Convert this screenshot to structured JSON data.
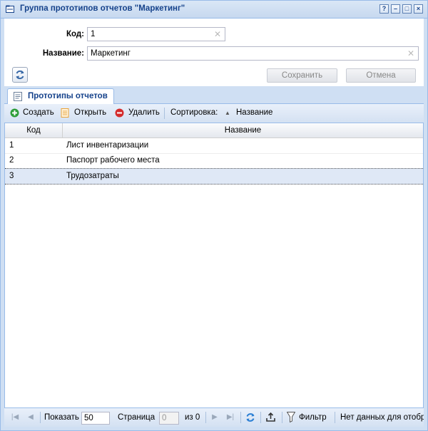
{
  "window": {
    "title": "Группа прототипов отчетов \"Маркетинг\"",
    "tools": {
      "help": "?",
      "minimize": "–",
      "maximize": "□",
      "close": "×"
    }
  },
  "form": {
    "code_label": "Код:",
    "code_value": "1",
    "name_label": "Название:",
    "name_value": "Маркетинг",
    "save_label": "Сохранить",
    "cancel_label": "Отмена"
  },
  "tab": {
    "label": "Прототипы отчетов"
  },
  "toolbar": {
    "create_label": "Создать",
    "open_label": "Открыть",
    "delete_label": "Удалить",
    "sort_label": "Сортировка:",
    "sort_field": "Название"
  },
  "grid": {
    "columns": [
      "Код",
      "Название"
    ],
    "rows": [
      {
        "code": "1",
        "name": "Лист инвентаризации"
      },
      {
        "code": "2",
        "name": "Паспорт рабочего места"
      },
      {
        "code": "3",
        "name": "Трудозатраты"
      }
    ],
    "selected_row": 3
  },
  "pager": {
    "show_label": "Показать",
    "page_size": "50",
    "page_label": "Страница",
    "page_value": "0",
    "of_label": "из 0",
    "filter_label": "Фильтр",
    "status": "Нет данных для отобра"
  },
  "colors": {
    "accent": "#15428b",
    "border": "#99bbe8",
    "create": "#2e9e3a",
    "delete": "#d42c2c",
    "open": "#e8a23a"
  }
}
